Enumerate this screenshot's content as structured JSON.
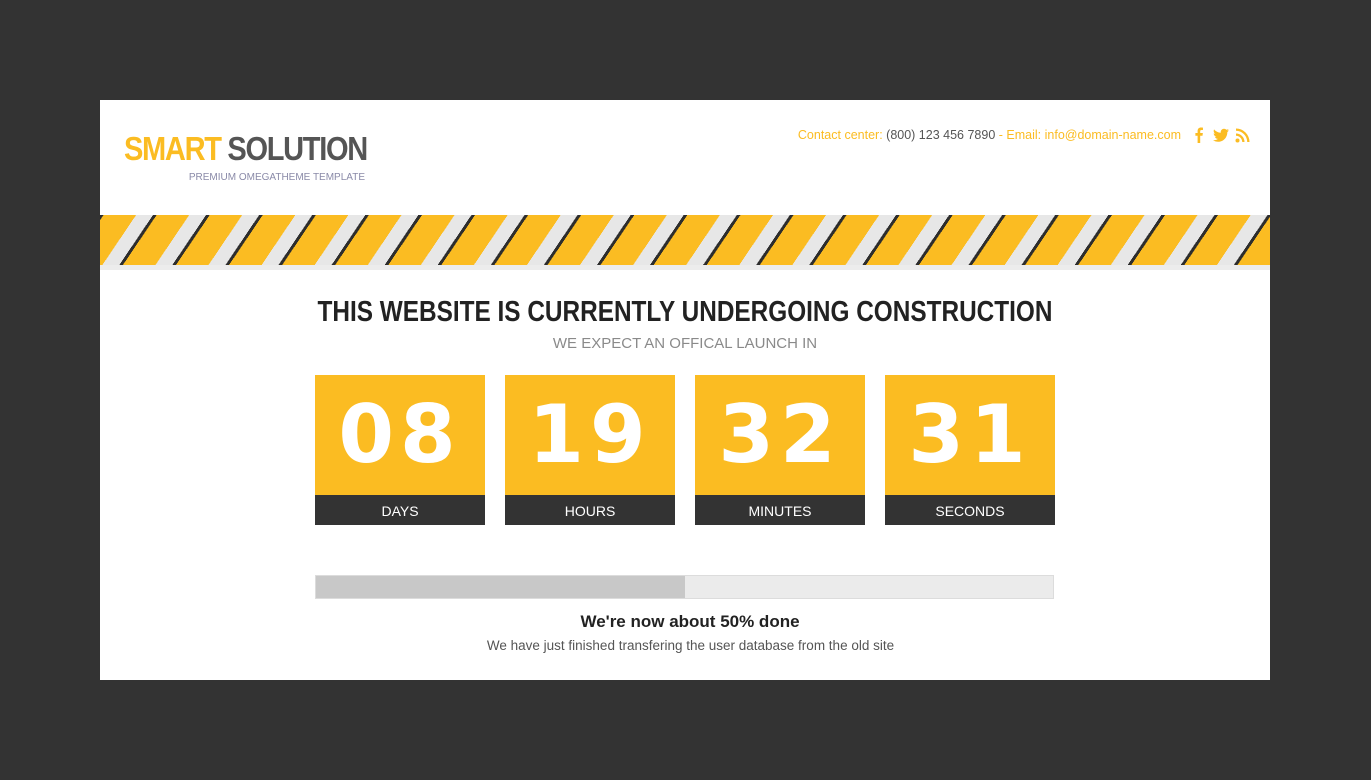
{
  "header": {
    "logo_part1": "SMART",
    "logo_part2": "SOLUTION",
    "tagline": "PREMIUM OMEGATHEME TEMPLATE",
    "contact_label": "Contact center:",
    "phone": "(800) 123 456 7890",
    "separator": "-",
    "email_label": "Email:",
    "email": "info@domain-name.com",
    "social_icons": [
      "facebook-icon",
      "twitter-icon",
      "rss-icon"
    ]
  },
  "main": {
    "headline": "THIS WEBSITE IS CURRENTLY UNDERGOING CONSTRUCTION",
    "subheadline": "WE EXPECT AN OFFICAL LAUNCH IN",
    "countdown": [
      {
        "value": "08",
        "label": "DAYS"
      },
      {
        "value": "19",
        "label": "HOURS"
      },
      {
        "value": "32",
        "label": "MINUTES"
      },
      {
        "value": "31",
        "label": "SECONDS"
      }
    ],
    "progress_percent": 50,
    "progress_title": "We're now about 50% done",
    "progress_text": "We have just finished transfering the user database from the old site"
  },
  "colors": {
    "accent": "#fbbc22",
    "dark": "#333333",
    "background": "#333333",
    "progress_fill": "#c8c8c8",
    "progress_track": "#ebebeb"
  }
}
